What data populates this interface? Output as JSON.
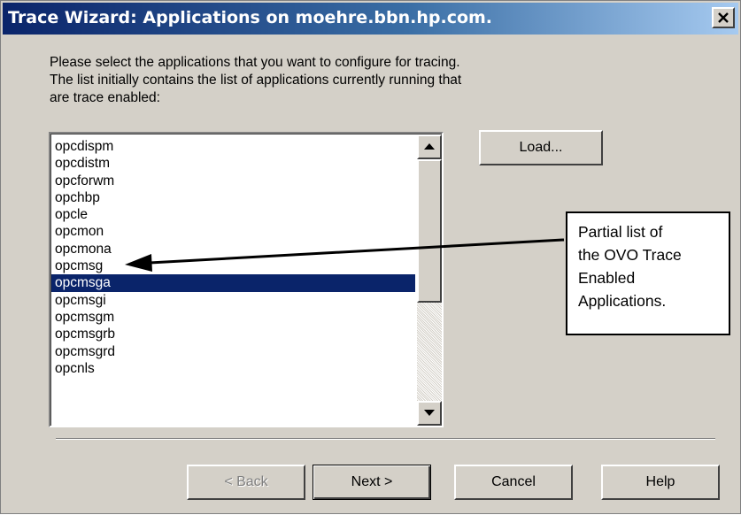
{
  "window": {
    "title": "Trace Wizard: Applications on moehre.bbn.hp.com.",
    "close_glyph": "✕"
  },
  "intro": {
    "line1": "Please select the applications that you want to configure for tracing.",
    "line2": "The list initially contains the list of applications currently running that",
    "line3": "are trace enabled:"
  },
  "app_list": {
    "items": [
      "opcdispm",
      "opcdistm",
      "opcforwm",
      "opchbp",
      "opcle",
      "opcmon",
      "opcmona",
      "opcmsg",
      "opcmsga",
      "opcmsgi",
      "opcmsgm",
      "opcmsgrb",
      "opcmsgrd",
      "opcnls"
    ],
    "selected": "opcmsga",
    "scroll_up_icon": "scroll-up-arrow",
    "scroll_down_icon": "scroll-down-arrow"
  },
  "load_button": {
    "label": "Load..."
  },
  "footer_buttons": {
    "back": "< Back",
    "next": "Next >",
    "cancel": "Cancel",
    "help": "Help"
  },
  "callout": {
    "line1": "Partial list of",
    "line2": "the OVO Trace",
    "line3": "Enabled",
    "line4": "Applications."
  },
  "colors": {
    "selection": "#0a246a",
    "titlebar_start": "#0a246a",
    "titlebar_end": "#a6caf0",
    "face": "#d4d0c8"
  }
}
